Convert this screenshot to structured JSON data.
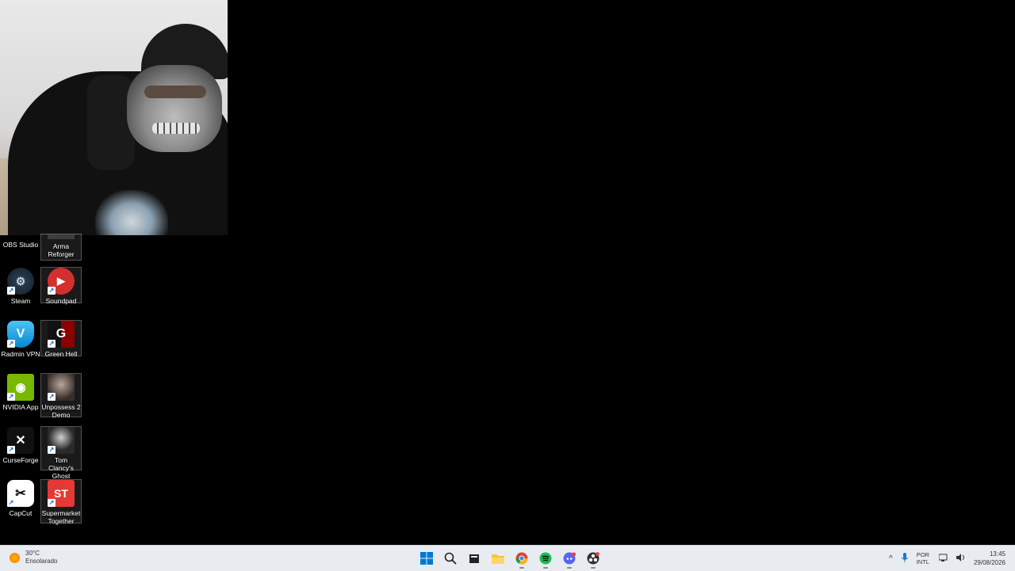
{
  "desktop": {
    "icons": [
      {
        "label": "OBS Studio",
        "icon": "obs-studio-icon",
        "color": "#2b2b2b"
      },
      {
        "label": "Arma Reforger",
        "icon": "arma-reforger-icon",
        "color": "#3b3f3a"
      },
      {
        "label": "Steam",
        "icon": "steam-icon",
        "color": "#1b2838"
      },
      {
        "label": "Soundpad",
        "icon": "soundpad-icon",
        "color": "#d32f2f"
      },
      {
        "label": "Radmin VPN",
        "icon": "radmin-vpn-icon",
        "color": "#29b6f6"
      },
      {
        "label": "Green Hell",
        "icon": "green-hell-icon",
        "color": "#8b0000"
      },
      {
        "label": "NVIDIA App",
        "icon": "nvidia-app-icon",
        "color": "#76b900"
      },
      {
        "label": "Unpossess 2 Demo",
        "icon": "unpossess-icon",
        "color": "#3a2e2a"
      },
      {
        "label": "CurseForge",
        "icon": "curseforge-icon",
        "color": "#111111"
      },
      {
        "label": "Tom Clancy's Ghost Reco...",
        "icon": "ghost-recon-icon",
        "color": "#2a2a2a"
      },
      {
        "label": "CapCut",
        "icon": "capcut-icon",
        "color": "#ffffff"
      },
      {
        "label": "Supermarket Together",
        "icon": "supermarket-together-icon",
        "color": "#e53935"
      }
    ]
  },
  "taskbar": {
    "weather": {
      "temp": "30°C",
      "condition": "Ensolarado"
    },
    "apps": [
      "start-icon",
      "search-icon",
      "task-view-icon",
      "file-explorer-icon",
      "chrome-icon",
      "spotify-icon",
      "discord-icon",
      "obs-icon"
    ],
    "language": {
      "line1": "POR",
      "line2": "INTL"
    },
    "clock": {
      "time": "13:45",
      "date": "29/08/2026"
    },
    "accent": "#0078d4"
  }
}
